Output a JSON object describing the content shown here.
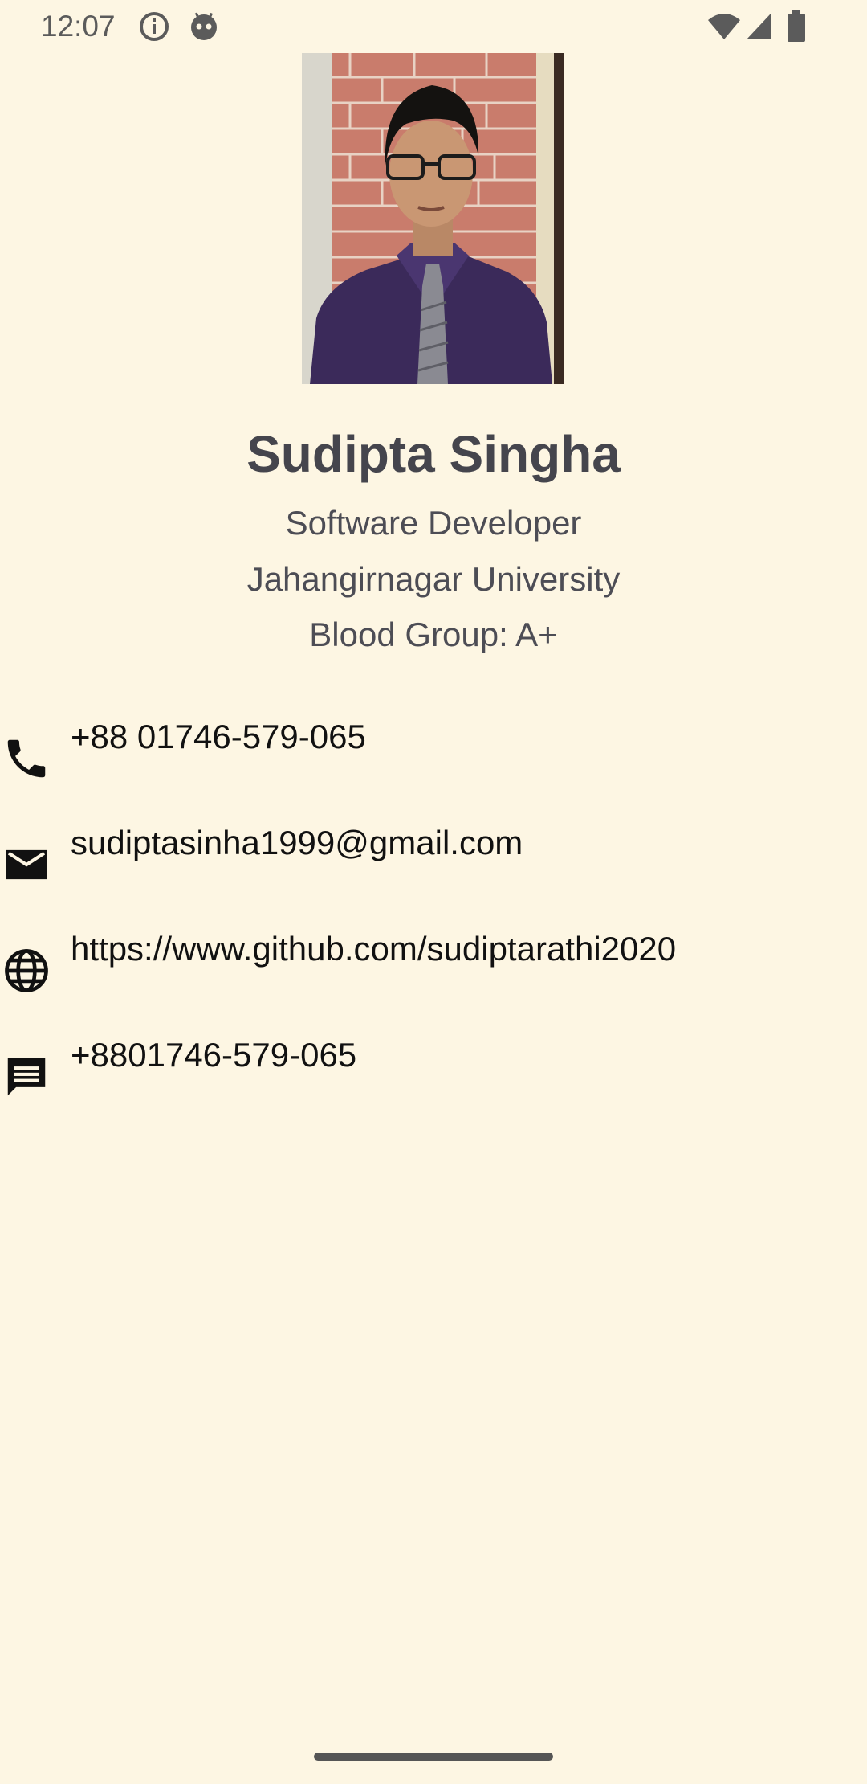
{
  "status_bar": {
    "time": "12:07",
    "left_icons": [
      "info-icon",
      "robot-icon"
    ],
    "right_icons": [
      "wifi-icon",
      "signal-icon",
      "battery-icon"
    ]
  },
  "profile": {
    "photo_icon": "profile-photo",
    "name": "Sudipta Singha",
    "title": "Software Developer",
    "institution": "Jahangirnagar University",
    "blood_group": "Blood Group: A+"
  },
  "contacts": [
    {
      "icon": "phone-icon",
      "text": "+88 01746-579-065"
    },
    {
      "icon": "email-icon",
      "text": "sudiptasinha1999@gmail.com"
    },
    {
      "icon": "globe-icon",
      "text": "https://www.github.com/sudiptarathi2020"
    },
    {
      "icon": "message-icon",
      "text": "+8801746-579-065"
    }
  ],
  "colors": {
    "background": "#fdf6e3",
    "name_text": "#45454d",
    "subtext": "#4d4d55",
    "contact_text": "#111111"
  }
}
